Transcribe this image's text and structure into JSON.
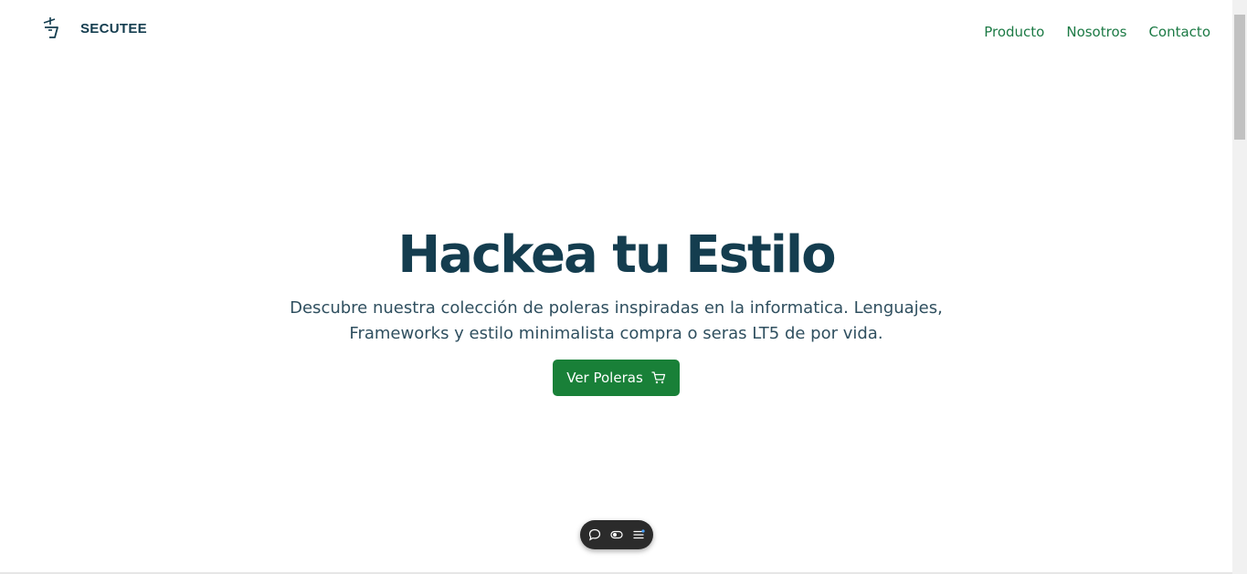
{
  "header": {
    "brand_name": "SECUTEE",
    "logo_icon": "secutee-logo-icon",
    "nav": [
      {
        "label": "Producto"
      },
      {
        "label": "Nosotros"
      },
      {
        "label": "Contacto"
      }
    ]
  },
  "hero": {
    "title": "Hackea tu Estilo",
    "description": "Descubre nuestra colección de poleras inspiradas en la informatica. Lenguajes, Frameworks y estilo minimalista compra o seras LT5 de por vida.",
    "cta_label": "Ver Poleras",
    "cta_icon": "cart-icon"
  },
  "floating_toolbar": {
    "icons": [
      "chat-bubble-icon",
      "toggle-icon",
      "menu-icon"
    ]
  },
  "colors": {
    "primary_dark": "#143d4f",
    "accent_green": "#198038",
    "nav_green": "#1c7a45",
    "toolbar_bg": "#2b2b2b"
  }
}
